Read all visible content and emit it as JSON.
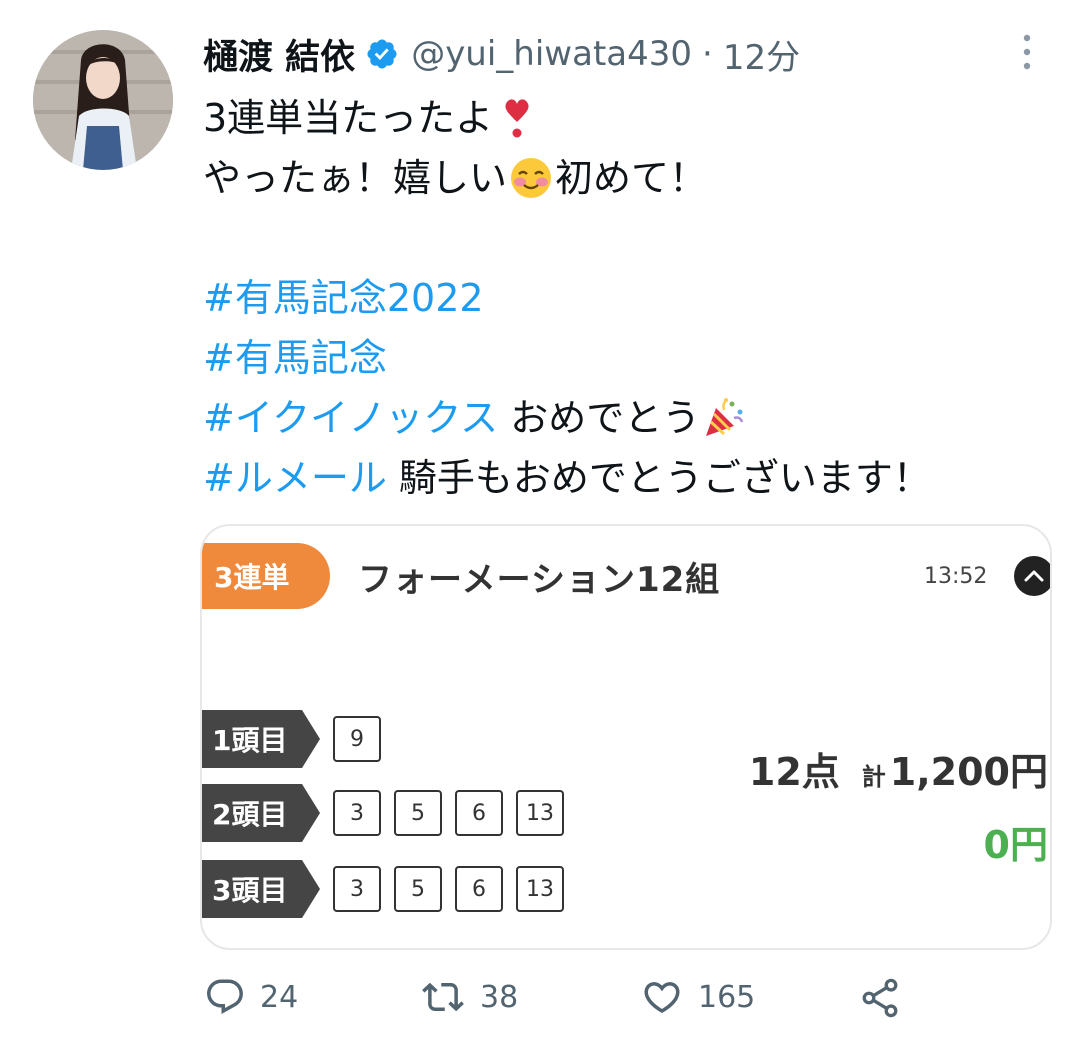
{
  "author": {
    "name": "樋渡 結依",
    "handle": "@yui_hiwata430",
    "separator": "·",
    "time": "12分"
  },
  "tweet": {
    "line1": "3連単当たったよ",
    "line2a": "やったぁ！嬉しい",
    "line2b": "初めて！",
    "hashtag1": "#有馬記念2022",
    "hashtag2": "#有馬記念",
    "hashtag3": "#イクイノックス",
    "hashtag3_text": " おめでとう",
    "hashtag4": "#ルメール",
    "hashtag4_text": " 騎手もおめでとうございます！"
  },
  "card": {
    "bet_type": "3連単",
    "title": "フォーメーション12組",
    "time": "13:52",
    "rows": [
      {
        "label": "1頭目",
        "numbers": [
          "9"
        ]
      },
      {
        "label": "2頭目",
        "numbers": [
          "3",
          "5",
          "6",
          "13"
        ]
      },
      {
        "label": "3頭目",
        "numbers": [
          "3",
          "5",
          "6",
          "13"
        ]
      }
    ],
    "points": "12点",
    "total_label": "計",
    "total": "1,200円",
    "payout": "0円",
    "badge_color": "#ef8a3c",
    "payout_color": "#4caf50"
  },
  "actions": {
    "reply_count": "24",
    "retweet_count": "38",
    "like_count": "165"
  },
  "icons": [
    "verified-badge-icon",
    "more-icon",
    "heart-exclamation-emoji-icon",
    "smiling-face-emoji-icon",
    "party-popper-emoji-icon",
    "collapse-chevron-icon",
    "reply-icon",
    "retweet-icon",
    "like-icon",
    "share-icon"
  ],
  "colors": {
    "hashtag": "#1d9bf0",
    "secondary_text": "#536471",
    "verified": "#1d9bf0"
  }
}
